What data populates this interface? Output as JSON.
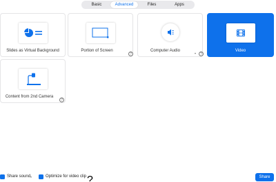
{
  "tabs": [
    {
      "label": "Basic",
      "active": false
    },
    {
      "label": "Advanced",
      "active": true
    },
    {
      "label": "Files",
      "active": false
    },
    {
      "label": "Apps",
      "active": false
    }
  ],
  "options": {
    "slides": {
      "label": "Slides as Virtual Background",
      "icon": "pie-chart-slide-icon"
    },
    "portion": {
      "label": "Portion of Screen",
      "icon": "screen-portion-icon"
    },
    "audio": {
      "label": "Computer Audio",
      "icon": "speaker-icon"
    },
    "video": {
      "label": "Video",
      "icon": "film-icon",
      "selected": true
    },
    "camera": {
      "label": "Content from 2nd Camera",
      "icon": "document-camera-icon"
    }
  },
  "footer": {
    "share_sound": {
      "label": "Share sound",
      "checked": true
    },
    "optimize_video": {
      "label": "Optimize for video clip",
      "checked": true
    },
    "share_button": "Share"
  },
  "colors": {
    "accent": "#0e71eb",
    "tab_background": "#e9e9ec",
    "card_border": "#e4e4e6"
  }
}
